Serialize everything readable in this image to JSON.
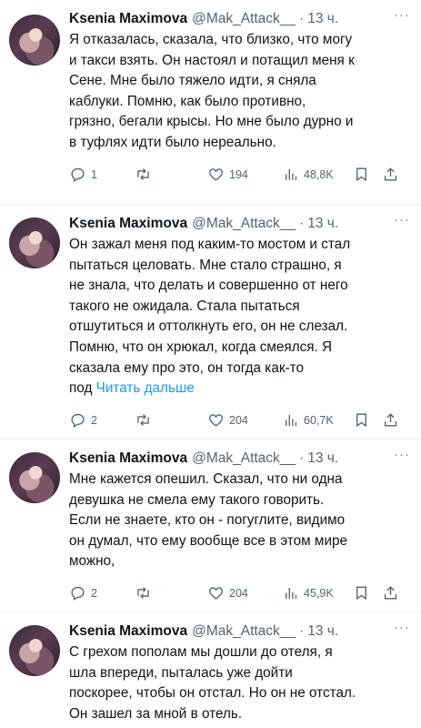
{
  "tweets": [
    {
      "name": "Ksenia Maximova",
      "handle": "@Mak_Attack__",
      "dot": "·",
      "time": "13 ч.",
      "more": "···",
      "lines": [
        "Я отказалась, сказала, что близко, что могу",
        "и такси взять. Он настоял и потащил меня к",
        "Сене. Мне было тяжело идти, я сняла",
        "каблуки. Помню, как было противно,",
        "грязно, бегали крысы. Но мне было дурно и",
        "в туфлях идти было нереально."
      ],
      "read_more": "",
      "replies": "1",
      "retweets": "",
      "likes": "194",
      "views": "48,8K"
    },
    {
      "name": "Ksenia Maximova",
      "handle": "@Mak_Attack__",
      "dot": "·",
      "time": "13 ч.",
      "more": "···",
      "lines": [
        "Он зажал меня под каким-то мостом и стал",
        "пытаться целовать. Мне стало страшно, я",
        "не знала, что делать и совершенно от него",
        "такого не ожидала. Стала пытаться",
        "отшутиться и оттолкнуть его, он не слезал.",
        "Помню, что он хрюкал, когда смеялся. Я",
        "сказала ему про это, он тогда как-то",
        "под"
      ],
      "read_more": "Читать дальше",
      "replies": "2",
      "retweets": "",
      "likes": "204",
      "views": "60,7K"
    },
    {
      "name": "Ksenia Maximova",
      "handle": "@Mak_Attack__",
      "dot": "·",
      "time": "13 ч.",
      "more": "···",
      "lines": [
        "Мне кажется опешил. Сказал, что ни одна",
        "девушка не смела ему такого говорить.",
        "Если не знаете, кто он - погуглите, видимо",
        "он думал, что ему вообще все в этом мире",
        "можно,"
      ],
      "read_more": "",
      "replies": "2",
      "retweets": "",
      "likes": "204",
      "views": "45,9K"
    },
    {
      "name": "Ksenia Maximova",
      "handle": "@Mak_Attack__",
      "dot": "·",
      "time": "13 ч.",
      "more": "···",
      "lines": [
        "С грехом пополам мы дошли до отеля, я",
        "шла впереди, пыталась уже дойти",
        "поскорее, чтобы он отстал. Но он не отстал.",
        "Он зашел за мной в отель."
      ],
      "read_more": "",
      "replies": "",
      "retweets": "",
      "likes": "",
      "views": ""
    }
  ]
}
